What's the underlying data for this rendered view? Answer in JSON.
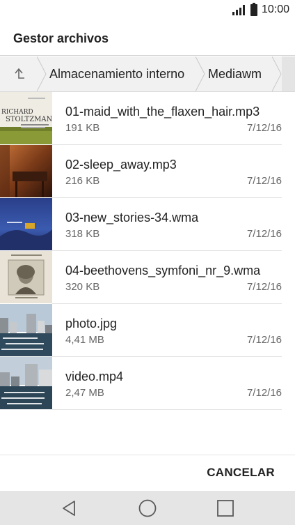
{
  "status_bar": {
    "time": "10:00"
  },
  "app_bar": {
    "title": "Gestor archivos"
  },
  "breadcrumb": {
    "items": [
      "Almacenamiento interno",
      "Mediawm"
    ]
  },
  "files": [
    {
      "name": "01-maid_with_the_flaxen_hair.mp3",
      "size": "191 KB",
      "date": "7/12/16",
      "thumbnail": "album-richard-stoltzman"
    },
    {
      "name": "02-sleep_away.mp3",
      "size": "216 KB",
      "date": "7/12/16",
      "thumbnail": "album-sleep-away"
    },
    {
      "name": "03-new_stories-34.wma",
      "size": "318 KB",
      "date": "7/12/16",
      "thumbnail": "album-new-stories"
    },
    {
      "name": "04-beethovens_symfoni_nr_9.wma",
      "size": "320 KB",
      "date": "7/12/16",
      "thumbnail": "album-beethoven"
    },
    {
      "name": "photo.jpg",
      "size": "4,41 MB",
      "date": "7/12/16",
      "thumbnail": "harbor-photo"
    },
    {
      "name": "video.mp4",
      "size": "2,47 MB",
      "date": "7/12/16",
      "thumbnail": "harbor-video"
    }
  ],
  "actions": {
    "cancel_label": "CANCELAR"
  },
  "nav_bar": {
    "icons": [
      "back-icon",
      "home-icon",
      "recents-icon"
    ]
  },
  "thumbnail_text": {
    "album_1_line_1": "RICHARD",
    "album_1_line_2": "STOLTZMAN"
  },
  "colors": {
    "background": "#ffffff",
    "breadcrumb_bg": "#f1f1f1",
    "nav_bg": "#e5e5e5",
    "secondary_text": "#666666"
  }
}
